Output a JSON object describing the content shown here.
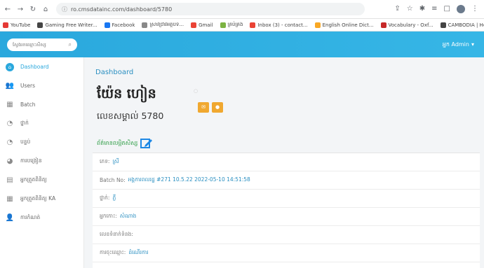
{
  "browser": {
    "url": "ro.cmsdatainc.com/dashboard/5780",
    "bookmarks": [
      {
        "label": "YouTube",
        "color": "#e53935"
      },
      {
        "label": "Gaming Free Writer...",
        "color": "#444444"
      },
      {
        "label": "Facebook",
        "color": "#1877f2"
      },
      {
        "label": "ស្រាវជ្រាវអត្ថបទ...",
        "color": "#888888"
      },
      {
        "label": "Gmail",
        "color": "#ea4335"
      },
      {
        "label": "គ្រប់គ្រង",
        "color": "#7cb342"
      },
      {
        "label": "Inbox (3) - contact...",
        "color": "#ea4335"
      },
      {
        "label": "English Online Dict...",
        "color": "#f9a825"
      },
      {
        "label": "Vocabulary - Oxf...",
        "color": "#c62828"
      },
      {
        "label": "CAMBODIA | Home",
        "color": "#444444"
      }
    ]
  },
  "header": {
    "search_placeholder": "ស្វែងរកឈ្មោះសិស្ស",
    "user_label": "អ្នក Admin"
  },
  "sidebar": {
    "items": [
      {
        "label": "Dashboard",
        "icon": "dashboard-icon",
        "glyph": "⌂",
        "active": true
      },
      {
        "label": "Users",
        "icon": "users-icon",
        "glyph": "👥"
      },
      {
        "label": "Batch",
        "icon": "batch-icon",
        "glyph": "▦"
      },
      {
        "label": "ថ្នាក់",
        "icon": "class-icon",
        "glyph": "◔"
      },
      {
        "label": "បន្ទប់",
        "icon": "room-icon",
        "glyph": "◔"
      },
      {
        "label": "ការបង្រៀន",
        "icon": "teaching-icon",
        "glyph": "◕"
      },
      {
        "label": "អ្នកត្រួតពិនិត្យ",
        "icon": "list-icon",
        "glyph": "▤"
      },
      {
        "label": "អ្នកត្រួតពិនិត្យ KA",
        "icon": "table-icon",
        "glyph": "▦"
      },
      {
        "label": "ការកំណត់",
        "icon": "person-icon",
        "glyph": "👤"
      }
    ]
  },
  "main": {
    "breadcrumb": "Dashboard",
    "student_name": "យ៉ែន ហៀន",
    "student_id_line": "លេខសម្គាល់ 5780",
    "section_title": "ព័ត៌មានលម្អិតសិស្ស",
    "rows": [
      {
        "label": "ភេទ:",
        "value": "ស្រី"
      },
      {
        "label": "Batch No:",
        "value": "អង្គការពលរដ្ឋ #271 10.5.22 2022-05-10 14:51:58"
      },
      {
        "label": "ថ្នាក់:",
        "value": "ភ្លឺ"
      },
      {
        "label": "អ្នកកោះ:",
        "value": "សំណាង"
      },
      {
        "label": "លេខទំនាក់ទំនង:",
        "value": ""
      },
      {
        "label": "ការចុះឈ្មោះ:",
        "value": "ដំណើរការ"
      }
    ]
  },
  "colors": {
    "accent": "#2aa8dd",
    "action": "#f0a830",
    "section": "#2e9d45",
    "link": "#2a8fc1"
  }
}
